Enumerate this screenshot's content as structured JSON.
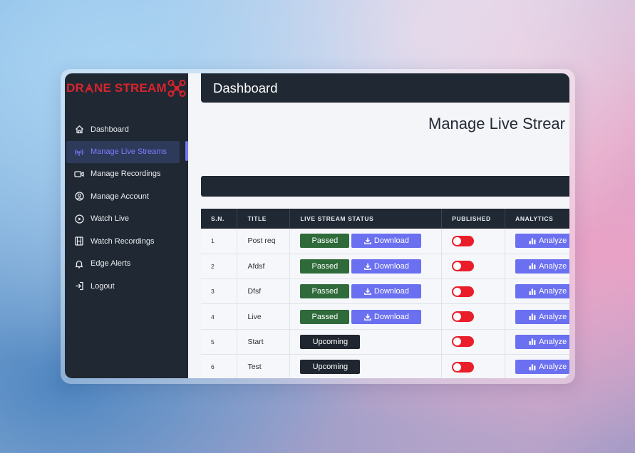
{
  "brand": {
    "logo_text_left": "DR",
    "logo_text_right": "NE STREAM",
    "color": "#d8242c"
  },
  "sidebar": {
    "items": [
      {
        "label": "Dashboard",
        "icon": "home-icon"
      },
      {
        "label": "Manage Live Streams",
        "icon": "broadcast-icon",
        "active": true
      },
      {
        "label": "Manage Recordings",
        "icon": "video-camera-icon"
      },
      {
        "label": "Manage Account",
        "icon": "user-circle-icon"
      },
      {
        "label": "Watch Live",
        "icon": "play-circle-icon"
      },
      {
        "label": "Watch Recordings",
        "icon": "film-icon"
      },
      {
        "label": "Edge Alerts",
        "icon": "bell-icon"
      },
      {
        "label": "Logout",
        "icon": "logout-icon"
      }
    ]
  },
  "header": {
    "title": "Dashboard"
  },
  "page": {
    "title": "Manage Live Strear"
  },
  "table": {
    "columns": [
      "S.N.",
      "TITLE",
      "LIVE STREAM STATUS",
      "PUBLISHED",
      "ANALYTICS"
    ],
    "rows": [
      {
        "sn": "1",
        "title": "Post req",
        "status": "Passed",
        "download": "Download",
        "published": false,
        "analyze": "Analyze"
      },
      {
        "sn": "2",
        "title": "Afdsf",
        "status": "Passed",
        "download": "Download",
        "published": false,
        "analyze": "Analyze"
      },
      {
        "sn": "3",
        "title": "Dfsf",
        "status": "Passed",
        "download": "Download",
        "published": false,
        "analyze": "Analyze"
      },
      {
        "sn": "4",
        "title": "Live",
        "status": "Passed",
        "download": "Download",
        "published": false,
        "analyze": "Analyze"
      },
      {
        "sn": "5",
        "title": "Start",
        "status": "Upcoming",
        "download": "",
        "published": false,
        "analyze": "Analyze"
      },
      {
        "sn": "6",
        "title": "Test",
        "status": "Upcoming",
        "download": "",
        "published": false,
        "analyze": "Analyze"
      }
    ]
  },
  "colors": {
    "sidebar_bg": "#202833",
    "accent": "#6b70f0",
    "passed": "#2f6a3b",
    "upcoming": "#1f2630",
    "toggle_off": "#ea1d2a"
  }
}
